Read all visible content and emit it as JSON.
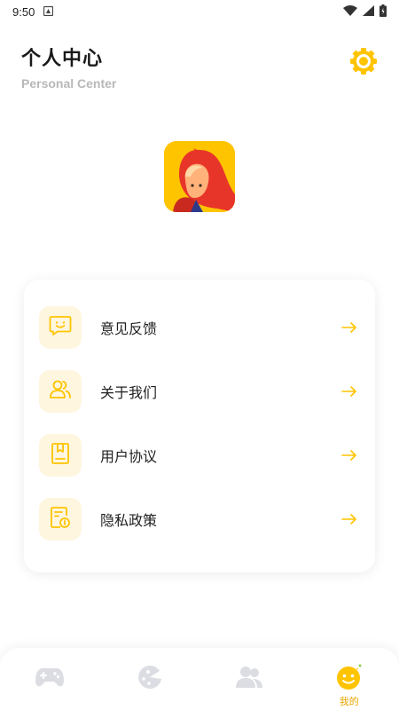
{
  "status_bar": {
    "time": "9:50"
  },
  "header": {
    "title": "个人中心",
    "subtitle": "Personal Center"
  },
  "settings": {
    "icon": "gear-icon"
  },
  "menu": {
    "items": [
      {
        "label": "意见反馈",
        "icon": "feedback-icon"
      },
      {
        "label": "关于我们",
        "icon": "users-icon"
      },
      {
        "label": "用户协议",
        "icon": "agreement-icon"
      },
      {
        "label": "隐私政策",
        "icon": "privacy-icon"
      }
    ]
  },
  "bottom_nav": {
    "tabs": [
      {
        "icon": "gamepad-icon",
        "label": "",
        "active": false
      },
      {
        "icon": "pacman-icon",
        "label": "",
        "active": false
      },
      {
        "icon": "community-icon",
        "label": "",
        "active": false
      },
      {
        "icon": "smiley-icon",
        "label": "我的",
        "active": true
      }
    ]
  },
  "colors": {
    "accent": "#ffc400",
    "accent_dark": "#e8a500",
    "icon_bg": "#fff6e0",
    "inactive_icon": "#dcdde3",
    "subtitle": "#b8b8b8"
  }
}
